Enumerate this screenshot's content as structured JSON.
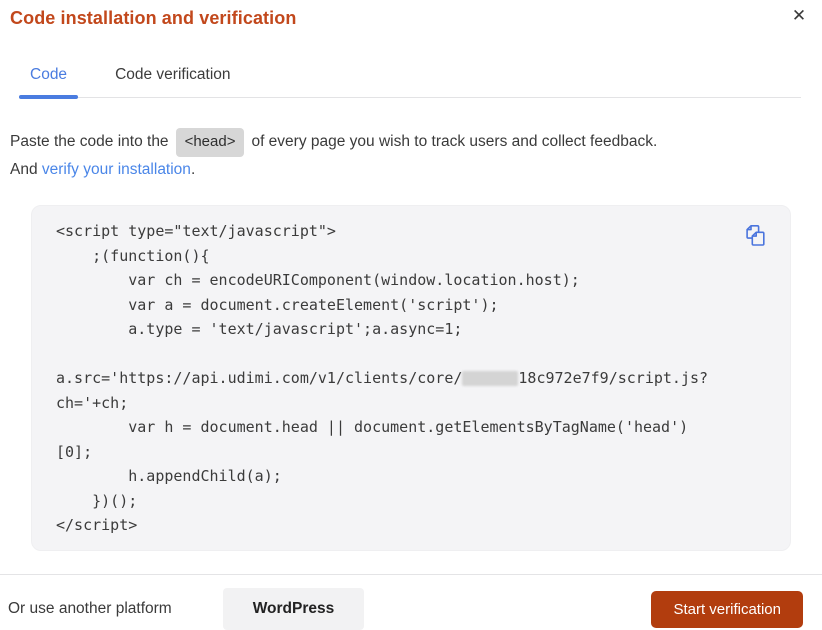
{
  "modal": {
    "title": "Code installation and verification",
    "close_icon": "✕"
  },
  "tabs": [
    {
      "label": "Code",
      "active": true
    },
    {
      "label": "Code verification",
      "active": false
    }
  ],
  "instructions": {
    "before_chip": "Paste the code into the",
    "chip": "<head>",
    "after_chip": "of every page you wish to track users and collect feedback.",
    "line2_prefix": "And ",
    "link": "verify your installation",
    "line2_suffix": "."
  },
  "code_block": {
    "copy_icon": "copy-icon",
    "lines": [
      {
        "segments": [
          {
            "t": "<script type=\"text/javascript\">"
          }
        ]
      },
      {
        "segments": [
          {
            "t": "    ;(function(){"
          }
        ]
      },
      {
        "segments": [
          {
            "t": "        var ch = encodeURIComponent(window.location.host);"
          }
        ]
      },
      {
        "segments": [
          {
            "t": "        var a = document.createElement('script');"
          }
        ]
      },
      {
        "segments": [
          {
            "t": "        a.type = 'text/javascript';a.async=1;"
          }
        ]
      },
      {
        "segments": [
          {
            "t": ""
          }
        ]
      },
      {
        "segments": [
          {
            "t": "a.src='https://api.udimi.com/v1/clients/core/"
          },
          {
            "redacted": true
          },
          {
            "t": "18c972e7f9/script.js?"
          }
        ]
      },
      {
        "segments": [
          {
            "t": "ch='+ch;"
          }
        ]
      },
      {
        "segments": [
          {
            "t": "        var h = document.head || document.getElementsByTagName('head')"
          }
        ]
      },
      {
        "segments": [
          {
            "t": "[0];"
          }
        ]
      },
      {
        "segments": [
          {
            "t": "        h.appendChild(a);"
          }
        ]
      },
      {
        "segments": [
          {
            "t": "    })();"
          }
        ]
      },
      {
        "segments": [
          {
            "t": "</script>"
          }
        ]
      }
    ]
  },
  "footer": {
    "alt_text": "Or use another platform",
    "wordpress_label": "WordPress",
    "start_label": "Start verification"
  },
  "colors": {
    "title": "#c2481c",
    "tab_active": "#4a7ce0",
    "link": "#4a86e8",
    "copy_icon": "#4a74dd",
    "primary_button": "#b23d0e",
    "primary_button_text": "#ffffff",
    "wordpress_button_bg": "#f2f2f3",
    "code_background": "#f4f4f6",
    "chip_background": "#d7d7d7"
  }
}
